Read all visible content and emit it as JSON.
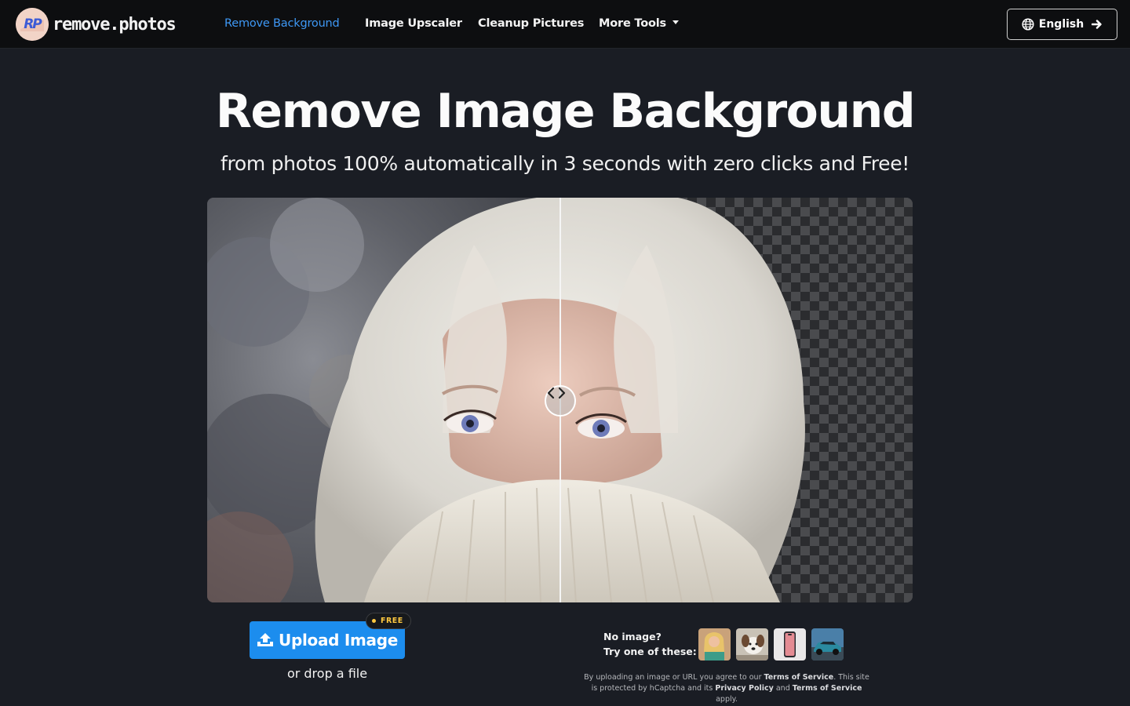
{
  "brand": {
    "name": "remove.photos",
    "mark": "RP"
  },
  "nav": {
    "items": [
      {
        "label": "Remove Background",
        "active": true
      },
      {
        "label": "Image Upscaler",
        "active": false
      },
      {
        "label": "Cleanup Pictures",
        "active": false
      },
      {
        "label": "More Tools",
        "active": false
      }
    ]
  },
  "language": {
    "label": "English",
    "icon": "globe-icon",
    "action_icon": "arrow-right-icon"
  },
  "hero": {
    "title": "Remove Image Background",
    "subtitle": "from photos 100% automatically in 3 seconds with zero clicks and Free!"
  },
  "upload": {
    "button_label": "Upload Image",
    "badge": "FREE",
    "drop_text": "or drop a file"
  },
  "samples": {
    "prompt_line1": "No image?",
    "prompt_line2": "Try one of these:",
    "items": [
      "sample-woman",
      "sample-dog",
      "sample-phone",
      "sample-car"
    ]
  },
  "legal": {
    "p1": "By uploading an image or URL you agree to our ",
    "tos": "Terms of Service",
    "p2": ". This site is protected by hCaptcha and its ",
    "privacy": "Privacy Policy",
    "p3": " and ",
    "tos2": "Terms of Service",
    "p4": " apply."
  },
  "colors": {
    "accent": "#1c8dee",
    "active_link": "#3e98f5",
    "badge": "#ffc940",
    "background": "#1a1d24"
  }
}
